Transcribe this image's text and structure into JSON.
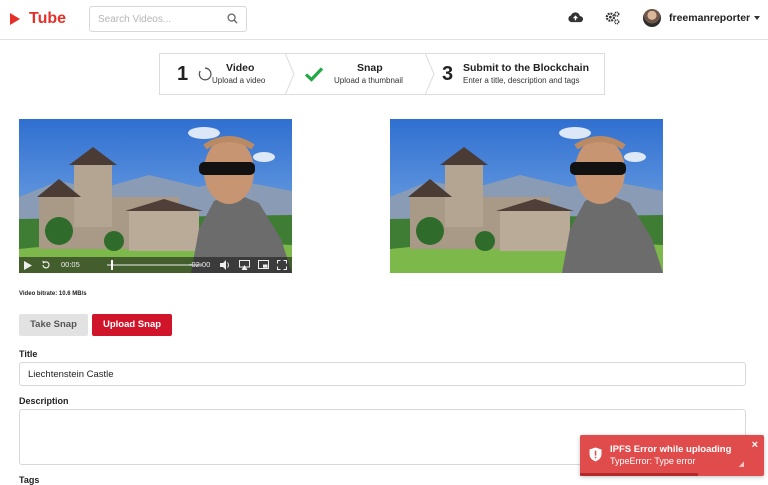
{
  "header": {
    "logo_text": "Tube",
    "search_placeholder": "Search Videos...",
    "icons": [
      "upload-cloud-icon",
      "settings-icon",
      "search-icon"
    ],
    "username": "freemanreporter"
  },
  "steps": [
    {
      "number": "1",
      "title": "Video",
      "subtitle": "Upload a video",
      "status": "in-progress"
    },
    {
      "number": "",
      "title": "Snap",
      "subtitle": "Upload a thumbnail",
      "status": "done"
    },
    {
      "number": "3",
      "title": "Submit to the Blockchain",
      "subtitle": "Enter a title, description and tags",
      "status": "pending"
    }
  ],
  "player": {
    "current_time": "00:05",
    "remaining_time": "-02:00",
    "playback_progress": 0.04
  },
  "bitrate_text": "Video bitrate: 10.6 MB/s",
  "buttons": {
    "take_snap": "Take Snap",
    "upload_snap": "Upload Snap"
  },
  "form": {
    "title_label": "Title",
    "title_value": "Liechtenstein Castle",
    "description_label": "Description",
    "description_value": "",
    "tags_label": "Tags"
  },
  "toast": {
    "title": "IPFS Error while uploading",
    "message": "TypeError: Type error",
    "close": "×"
  },
  "colors": {
    "brand": "#e5302a",
    "primary_button": "#d0152a",
    "success": "#22a846",
    "toast": "#e04c4c"
  }
}
